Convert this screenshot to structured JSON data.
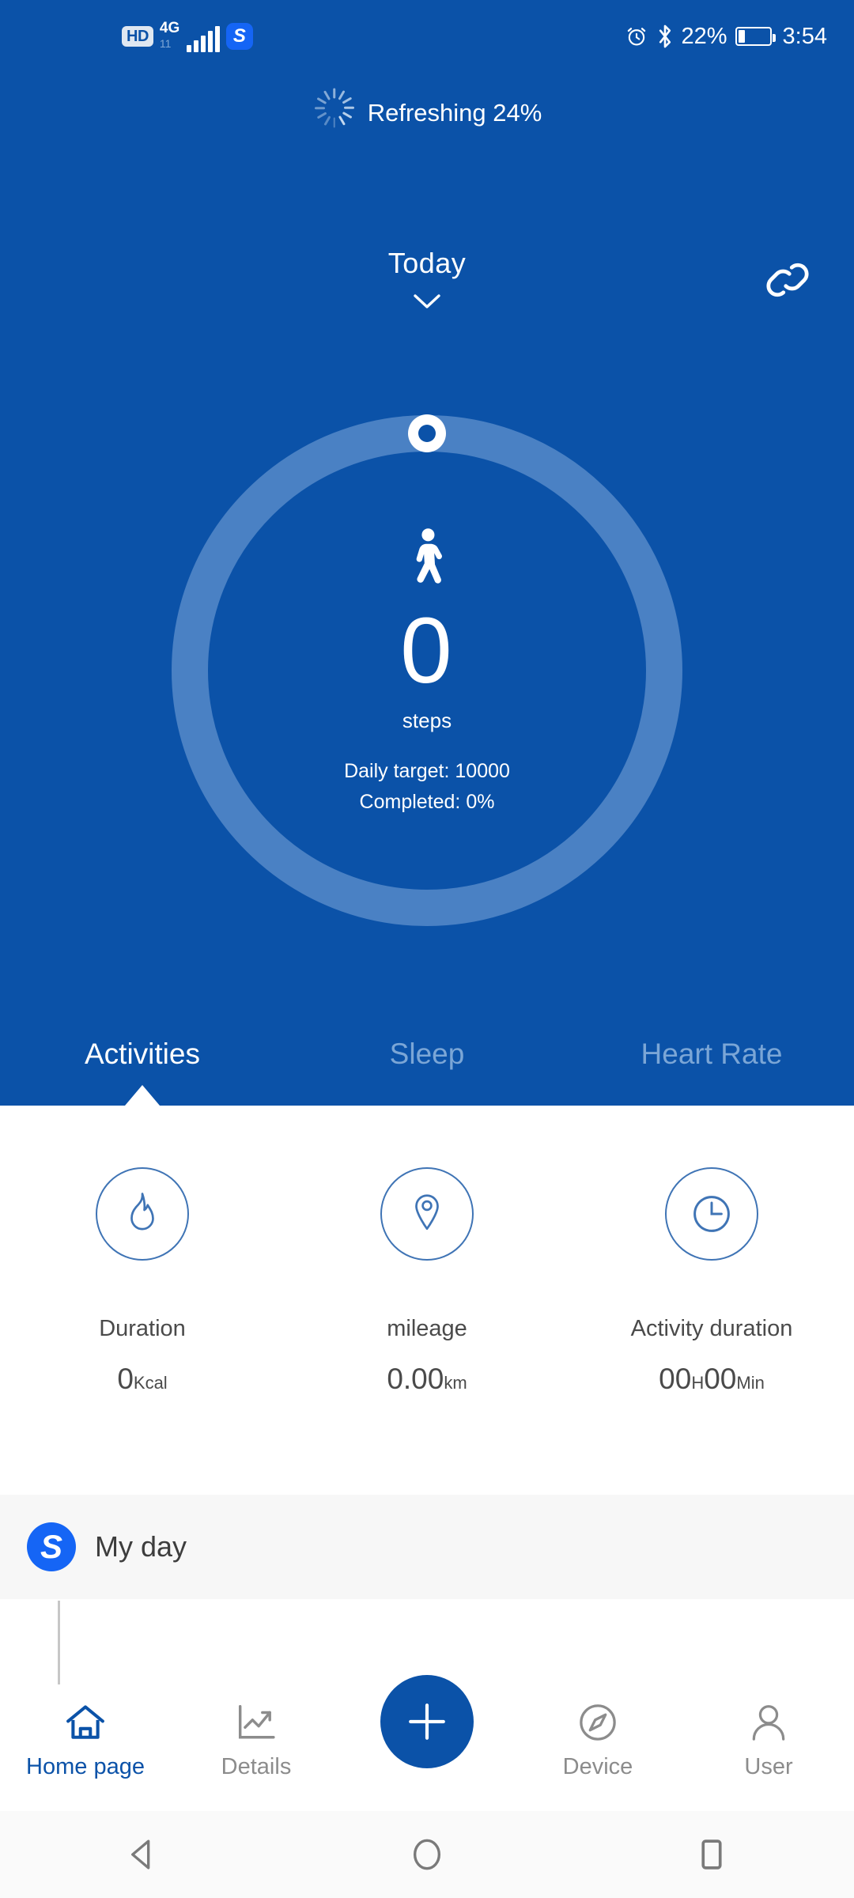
{
  "status_bar": {
    "hd_badge": "HD",
    "network_type": "4G",
    "network_sub": "11",
    "app_badge": "S",
    "alarm_icon": "alarm-clock-icon",
    "bluetooth_icon": "bluetooth-icon",
    "battery_percent": "22%",
    "battery_level": 22,
    "time": "3:54"
  },
  "refresh": {
    "label": "Refreshing 24%",
    "percent": 24,
    "spinner_icon": "loading-spinner-icon"
  },
  "header": {
    "title": "Today",
    "chevron_icon": "chevron-down-icon",
    "link_icon": "chain-link-icon"
  },
  "progress": {
    "activity_icon": "walking-person-icon",
    "value": "0",
    "unit": "steps",
    "daily_target": "Daily target: 10000",
    "completed": "Completed: 0%",
    "percent": 0,
    "track_color": "#4a81c4",
    "background_color": "#0b52a8"
  },
  "tabs": [
    {
      "label": "Activities",
      "active": true
    },
    {
      "label": "Sleep",
      "active": false
    },
    {
      "label": "Heart Rate",
      "active": false
    }
  ],
  "stats": [
    {
      "icon": "flame-icon",
      "label": "Duration",
      "value": "0",
      "unit": "Kcal"
    },
    {
      "icon": "location-pin-icon",
      "label": "mileage",
      "value": "0.00",
      "unit": "km"
    },
    {
      "icon": "clock-icon",
      "label": "Activity duration",
      "value": "00",
      "unit": "H",
      "value2": "00",
      "unit2": "Min"
    }
  ],
  "my_day": {
    "badge": "S",
    "label": "My day"
  },
  "bottom_nav": {
    "items": [
      {
        "icon": "home-icon",
        "label": "Home page",
        "active": true
      },
      {
        "icon": "chart-line-icon",
        "label": "Details",
        "active": false
      },
      {
        "icon": "compass-icon",
        "label": "Device",
        "active": false
      },
      {
        "icon": "person-icon",
        "label": "User",
        "active": false
      }
    ],
    "fab_icon": "plus-icon",
    "accent_color": "#0b52a8"
  },
  "system_nav": {
    "back_icon": "back-triangle-icon",
    "home_icon": "home-circle-icon",
    "recents_icon": "recents-square-icon"
  }
}
